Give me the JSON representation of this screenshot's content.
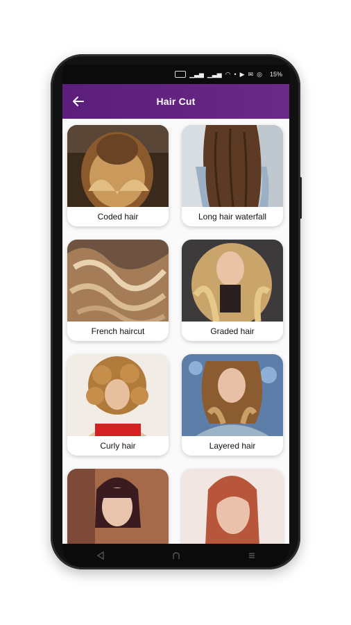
{
  "app": {
    "title": "Hair Cut",
    "back_icon": "arrow-left-icon",
    "accent": "#5b1e7a"
  },
  "status_bar": {
    "indicator": "15%",
    "icons": [
      "sim-icon",
      "signal-icon",
      "signal-icon",
      "wifi-icon",
      "dot-icon",
      "youtube-icon",
      "message-icon",
      "whatsapp-icon"
    ]
  },
  "items": [
    {
      "label": "Coded hair"
    },
    {
      "label": "Long hair waterfall"
    },
    {
      "label": "French haircut"
    },
    {
      "label": "Graded hair"
    },
    {
      "label": "Curly hair"
    },
    {
      "label": "Layered hair"
    },
    {
      "label": ""
    },
    {
      "label": ""
    }
  ],
  "nav_bar": {
    "icons": [
      "back-triangle-icon",
      "home-icon",
      "recents-icon"
    ]
  }
}
